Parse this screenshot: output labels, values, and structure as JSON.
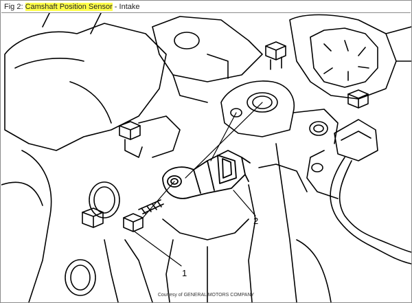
{
  "figure": {
    "prefix": "Fig 2:",
    "title": "Camshaft Position Sensor",
    "separator": " - ",
    "subtitle": "Intake",
    "highlight_color": "#ffff4a"
  },
  "callouts": [
    {
      "label": "1"
    },
    {
      "label": "2"
    }
  ],
  "credit": "Courtesy of GENERAL MOTORS COMPANY"
}
